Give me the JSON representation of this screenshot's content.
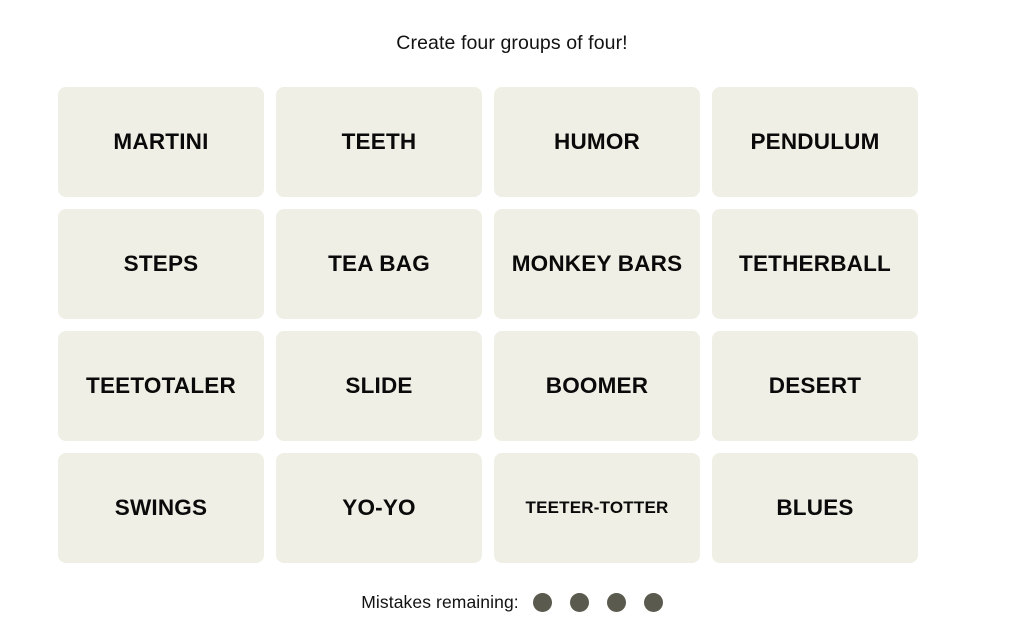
{
  "page": {
    "background_color": "#FFFFFF",
    "title": "Create four groups of four!"
  },
  "board": {
    "tile_color": "#EFEFE6",
    "tile_text_color": "#0A0A0A",
    "rows": 4,
    "columns": 4,
    "tiles": [
      {
        "label": "MARTINI",
        "size": "size-lg"
      },
      {
        "label": "TEETH",
        "size": "size-lg"
      },
      {
        "label": "HUMOR",
        "size": "size-lg"
      },
      {
        "label": "PENDULUM",
        "size": "size-lg"
      },
      {
        "label": "STEPS",
        "size": "size-lg"
      },
      {
        "label": "TEA BAG",
        "size": "size-lg"
      },
      {
        "label": "MONKEY BARS",
        "size": "size-lg"
      },
      {
        "label": "TETHERBALL",
        "size": "size-lg"
      },
      {
        "label": "TEETOTALER",
        "size": "size-lg"
      },
      {
        "label": "SLIDE",
        "size": "size-lg"
      },
      {
        "label": "BOOMER",
        "size": "size-lg"
      },
      {
        "label": "DESERT",
        "size": "size-lg"
      },
      {
        "label": "SWINGS",
        "size": "size-lg"
      },
      {
        "label": "YO-YO",
        "size": "size-lg"
      },
      {
        "label": "TEETER-TOTTER",
        "size": "size-sm"
      },
      {
        "label": "BLUES",
        "size": "size-lg"
      }
    ]
  },
  "mistakes": {
    "label": "Mistakes remaining:",
    "remaining": 4,
    "dot_color": "#5A5A4E"
  }
}
